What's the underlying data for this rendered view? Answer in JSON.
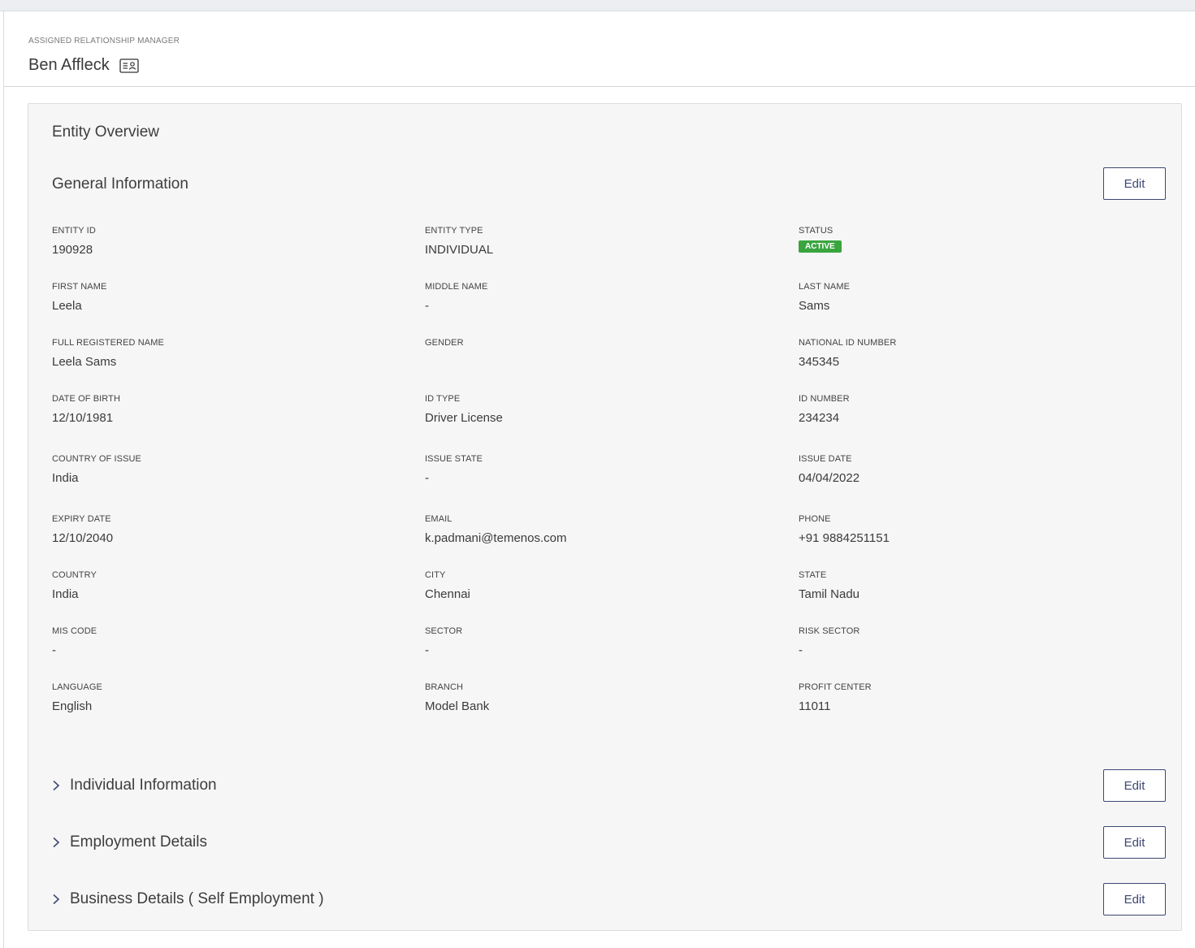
{
  "relationship_manager": {
    "label": "ASSIGNED RELATIONSHIP MANAGER",
    "name": "Ben Affleck"
  },
  "entity_overview": {
    "title": "Entity Overview",
    "general_information": {
      "title": "General Information",
      "edit_label": "Edit",
      "status": {
        "label": "STATUS",
        "value": "ACTIVE",
        "color": "#3aa53f"
      },
      "fields": [
        {
          "label": "ENTITY ID",
          "value": "190928"
        },
        {
          "label": "ENTITY TYPE",
          "value": "INDIVIDUAL"
        },
        {
          "label": "FIRST NAME",
          "value": "Leela"
        },
        {
          "label": "MIDDLE NAME",
          "value": "-"
        },
        {
          "label": "LAST NAME",
          "value": "Sams"
        },
        {
          "label": "FULL REGISTERED NAME",
          "value": "Leela Sams"
        },
        {
          "label": "GENDER",
          "value": ""
        },
        {
          "label": "NATIONAL ID NUMBER",
          "value": "345345"
        },
        {
          "label": "DATE OF BIRTH",
          "value": "12/10/1981"
        },
        {
          "label": "ID TYPE",
          "value": "Driver License"
        },
        {
          "label": "ID NUMBER",
          "value": "234234"
        },
        {
          "label": "COUNTRY OF ISSUE",
          "value": "India"
        },
        {
          "label": "ISSUE STATE",
          "value": "-"
        },
        {
          "label": "ISSUE DATE",
          "value": "04/04/2022"
        },
        {
          "label": "EXPIRY DATE",
          "value": "12/10/2040"
        },
        {
          "label": "EMAIL",
          "value": "k.padmani@temenos.com"
        },
        {
          "label": "PHONE",
          "value": "+91 9884251151"
        },
        {
          "label": "COUNTRY",
          "value": "India"
        },
        {
          "label": "CITY",
          "value": "Chennai"
        },
        {
          "label": "STATE",
          "value": "Tamil Nadu"
        },
        {
          "label": "MIS CODE",
          "value": "-"
        },
        {
          "label": "SECTOR",
          "value": "-"
        },
        {
          "label": "RISK SECTOR",
          "value": "-"
        },
        {
          "label": "LANGUAGE",
          "value": "English"
        },
        {
          "label": "BRANCH",
          "value": "Model Bank"
        },
        {
          "label": "PROFIT CENTER",
          "value": "11011"
        }
      ]
    },
    "collapsible_sections": [
      {
        "title": "Individual Information",
        "edit_label": "Edit"
      },
      {
        "title": "Employment Details",
        "edit_label": "Edit"
      },
      {
        "title": "Business Details ( Self Employment )",
        "edit_label": "Edit"
      }
    ]
  },
  "icons": {
    "contact_card": "contact-card-icon",
    "chevron": "chevron-right-icon"
  },
  "colors": {
    "accent": "#3d4773",
    "status_active": "#3aa53f"
  }
}
